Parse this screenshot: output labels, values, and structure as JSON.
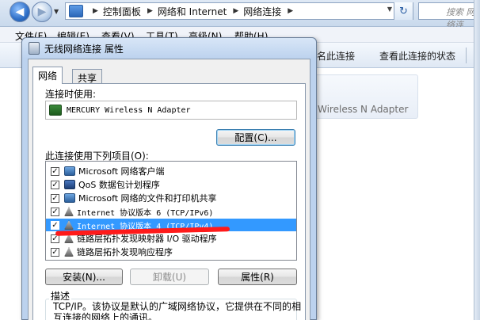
{
  "explorer": {
    "breadcrumb": [
      "控制面板",
      "网络和 Internet",
      "网络连接"
    ],
    "search_placeholder": "搜索 网络连",
    "menu": [
      "文件(F)",
      "编辑(E)",
      "查看(V)",
      "工具(T)",
      "高级(N)",
      "帮助(H)"
    ],
    "toolbar": [
      "名此连接",
      "查看此连接的状态"
    ],
    "adapter_tile": "Wireless N Adapter"
  },
  "dialog": {
    "title": "无线网络连接 属性",
    "tabs": [
      "网络",
      "共享"
    ],
    "connect_using_label": "连接时使用:",
    "adapter_name": "MERCURY Wireless N Adapter",
    "configure_button": "配置(C)...",
    "items_label": "此连接使用下列项目(O):",
    "items": [
      {
        "label": "Microsoft 网络客户端",
        "checked": true,
        "icon": "network-client-icon"
      },
      {
        "label": "QoS 数据包计划程序",
        "checked": true,
        "icon": "qos-icon"
      },
      {
        "label": "Microsoft 网络的文件和打印机共享",
        "checked": true,
        "icon": "file-share-icon"
      },
      {
        "label": "Internet 协议版本 6 (TCP/IPv6)",
        "checked": true,
        "icon": "protocol-icon"
      },
      {
        "label": "Internet 协议版本 4 (TCP/IPv4)",
        "checked": true,
        "icon": "protocol-icon",
        "selected": true
      },
      {
        "label": "链路层拓扑发现映射器 I/O 驱动程序",
        "checked": true,
        "icon": "protocol-icon"
      },
      {
        "label": "链路层拓扑发现响应程序",
        "checked": true,
        "icon": "protocol-icon"
      }
    ],
    "install_button": "安装(N)...",
    "uninstall_button": "卸载(U)",
    "properties_button": "属性(R)",
    "description_title": "描述",
    "description_text": "TCP/IP。该协议是默认的广域网络协议，它提供在不同的相互连接的网络上的通讯。"
  },
  "colors": {
    "selection": "#3399ff",
    "annotation_stroke": "#ff1a1a"
  }
}
